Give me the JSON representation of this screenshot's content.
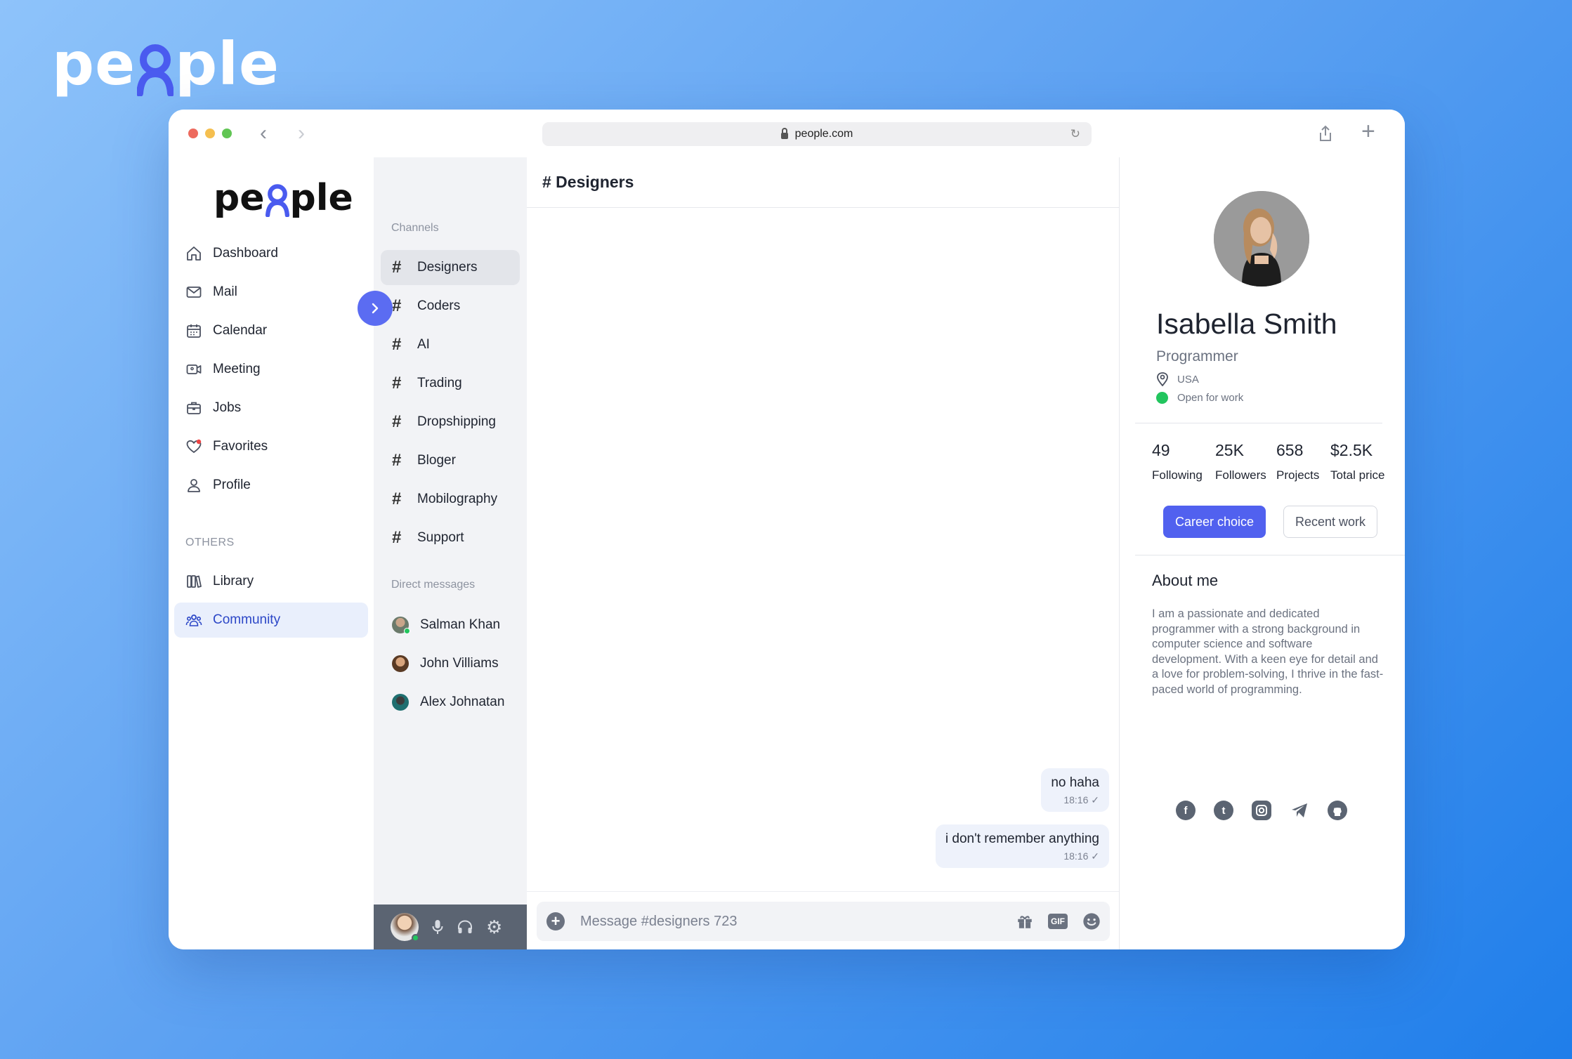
{
  "brand": {
    "name_left": "pe",
    "name_right": "ple"
  },
  "browser": {
    "url": "people.com"
  },
  "sidebar": {
    "logo_left": "pe",
    "logo_right": "ple",
    "items": [
      {
        "label": "Dashboard",
        "icon": "home-icon"
      },
      {
        "label": "Mail",
        "icon": "mail-icon"
      },
      {
        "label": "Calendar",
        "icon": "calendar-icon"
      },
      {
        "label": "Meeting",
        "icon": "video-icon"
      },
      {
        "label": "Jobs",
        "icon": "briefcase-icon"
      },
      {
        "label": "Favorites",
        "icon": "heart-icon"
      },
      {
        "label": "Profile",
        "icon": "user-icon"
      }
    ],
    "others_label": "OTHERS",
    "others_items": [
      {
        "label": "Library",
        "icon": "library-icon"
      },
      {
        "label": "Community",
        "icon": "community-icon"
      }
    ]
  },
  "channels": {
    "label": "Channels",
    "items": [
      "Designers",
      "Coders",
      "AI",
      "Trading",
      "Dropshipping",
      "Bloger",
      "Mobilography",
      "Support"
    ],
    "dm_label": "Direct messages",
    "dms": [
      "Salman Khan",
      "John Villiams",
      "Alex Johnatan"
    ]
  },
  "chat": {
    "title": "# Designers",
    "messages": [
      {
        "text": "no haha",
        "time": "18:16 ✓"
      },
      {
        "text": "i don't remember anything",
        "time": "18:16 ✓"
      }
    ],
    "composer_placeholder": "Message #designers 723",
    "gif_label": "GIF"
  },
  "profile": {
    "name": "Isabella Smith",
    "role": "Programmer",
    "location": "USA",
    "status": "Open for work",
    "stats": [
      {
        "value": "49",
        "label": "Following"
      },
      {
        "value": "25K",
        "label": "Followers"
      },
      {
        "value": "658",
        "label": "Projects"
      },
      {
        "value": "$2.5K",
        "label": "Total price"
      }
    ],
    "primary_button": "Career choice",
    "secondary_button": "Recent work",
    "about_title": "About me",
    "about_text": "I am a passionate and dedicated programmer with a strong background in computer science and software development. With a keen eye for detail and a love for problem-solving, I thrive in the fast-paced world of programming.",
    "socials": [
      "facebook-icon",
      "twitter-icon",
      "instagram-icon",
      "telegram-icon",
      "github-icon"
    ]
  },
  "colors": {
    "accent": "#5161ef",
    "active_nav_text": "#2c47c7",
    "online": "#22c55e"
  }
}
